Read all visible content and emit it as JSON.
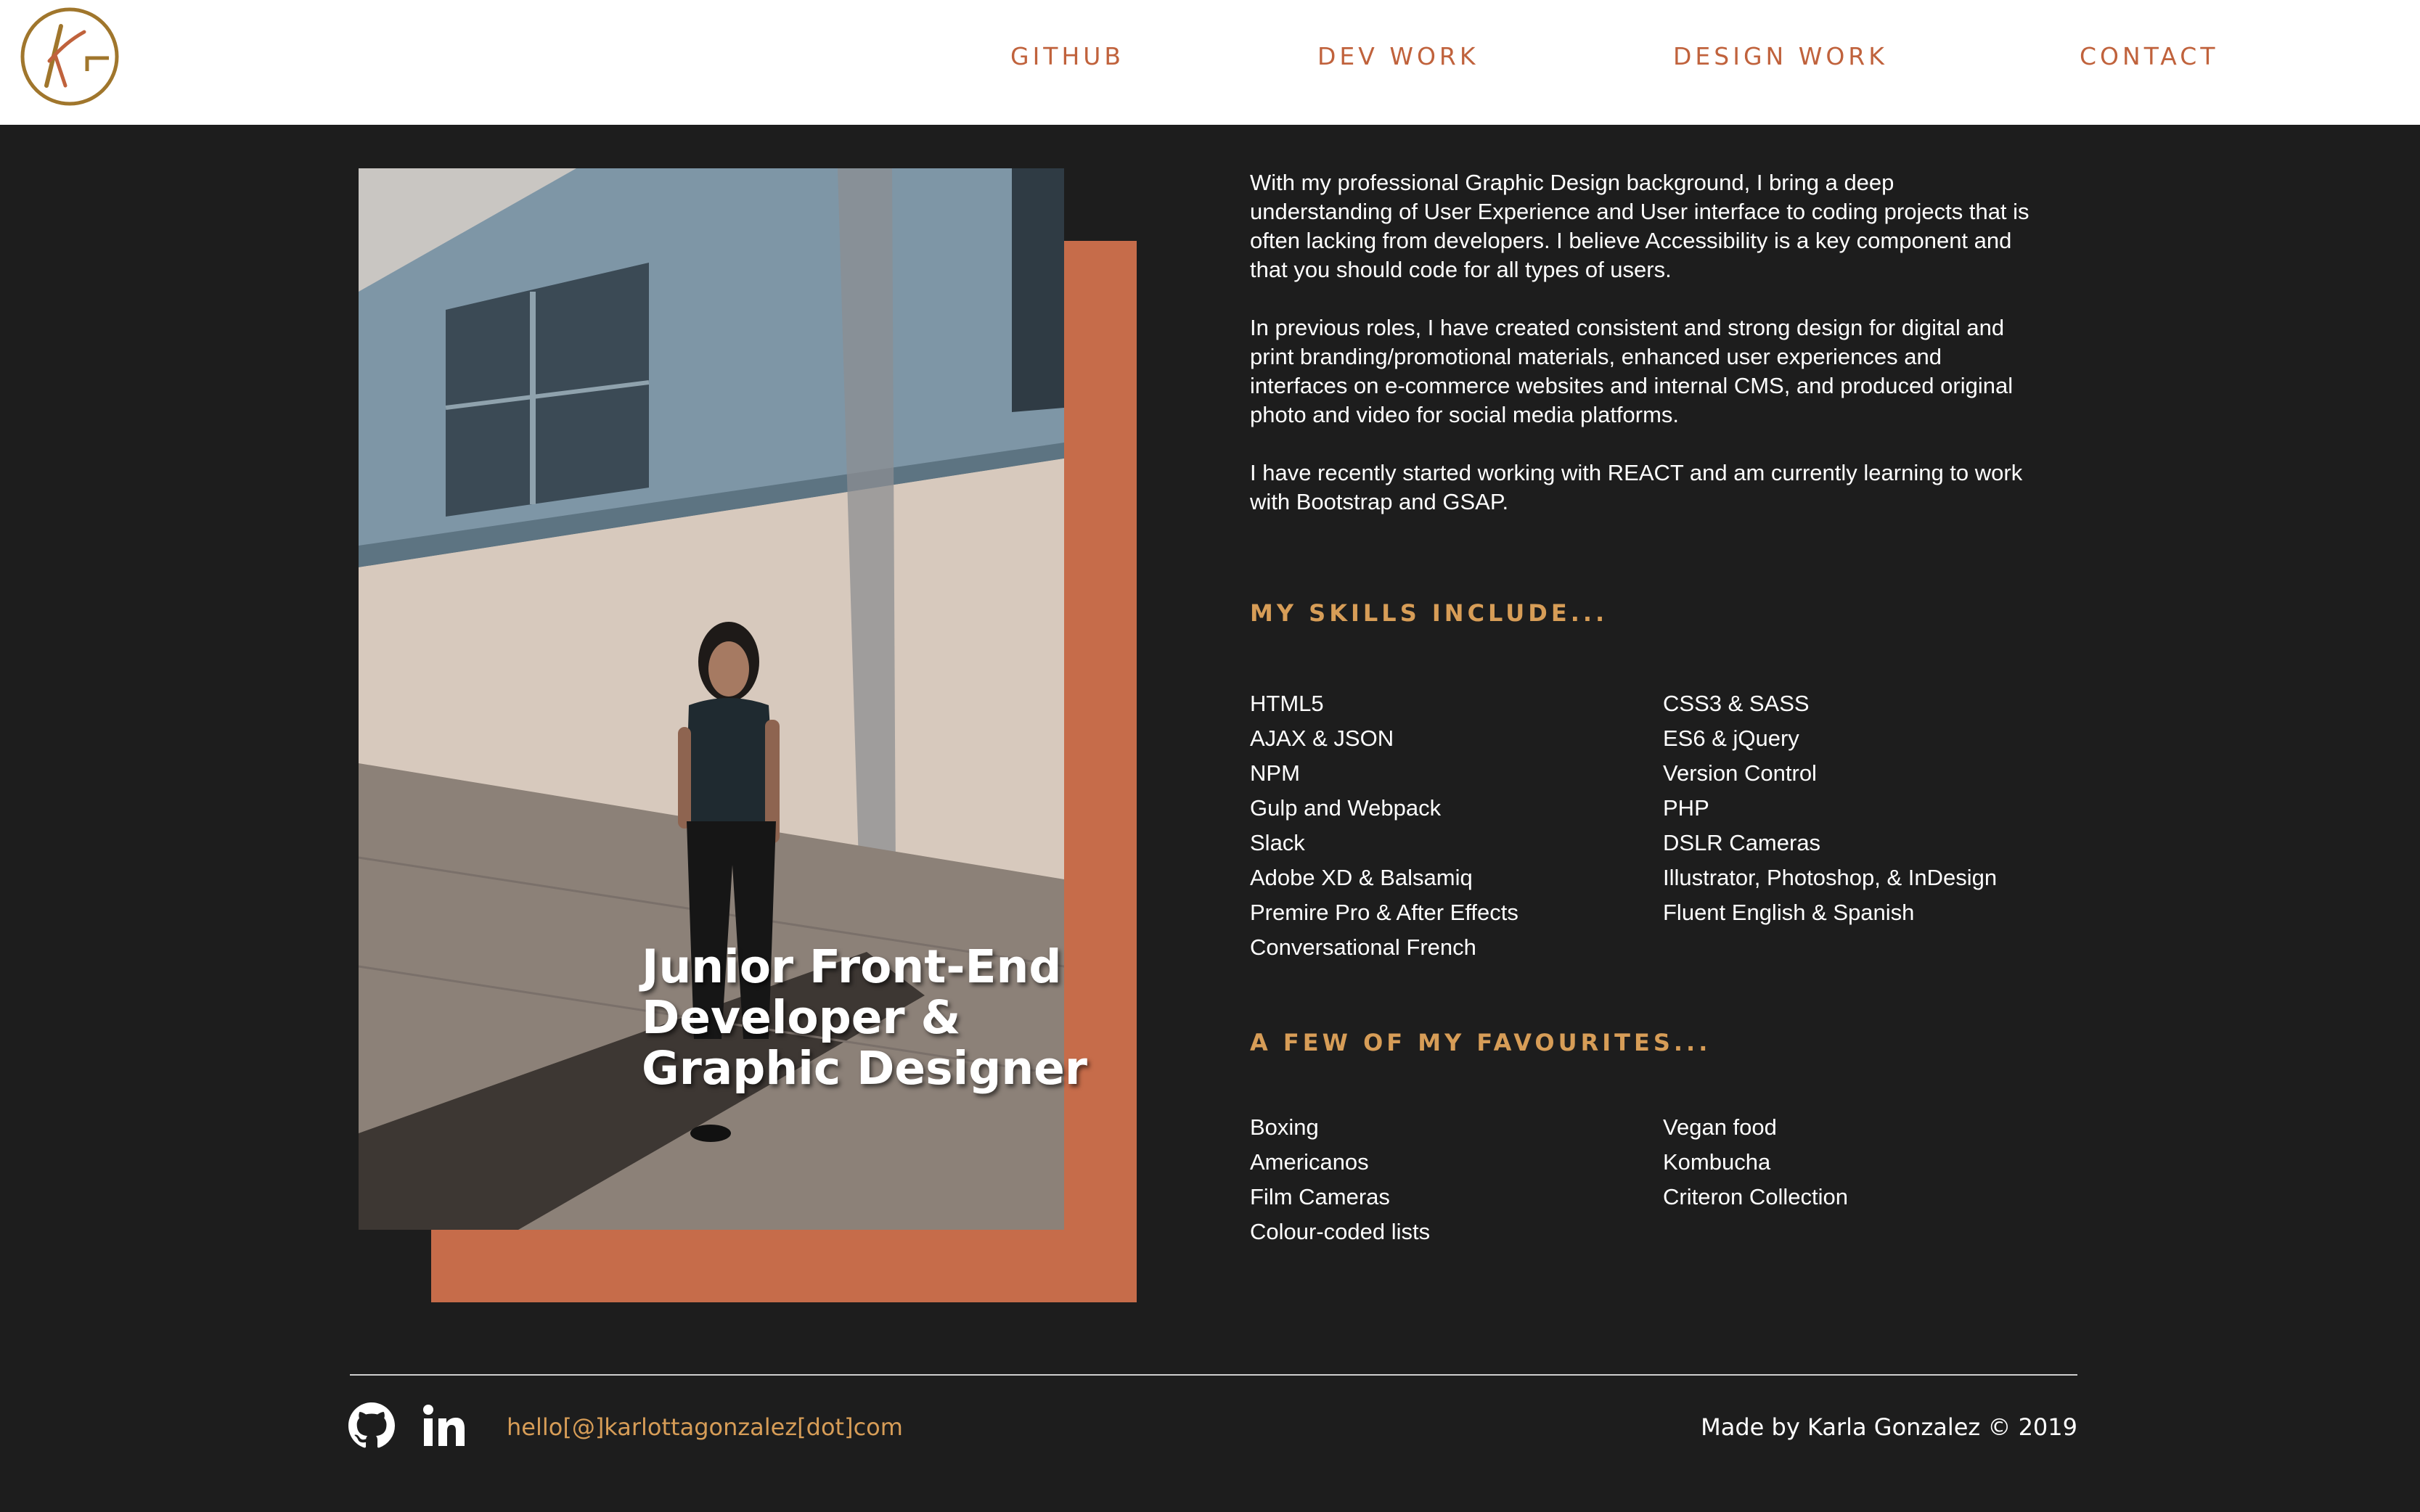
{
  "brand": {
    "logo_icon": "kg-monogram-icon",
    "accent": "#c0623c",
    "gold": "#a0762c",
    "heading_color": "#d79d57",
    "background": "#1d1d1d"
  },
  "nav": {
    "github": "GITHUB",
    "dev_work": "DEV WORK",
    "design_work": "DESIGN WORK",
    "contact": "CONTACT"
  },
  "hero": {
    "title_line1": "Junior Front-End",
    "title_line2": "Developer &",
    "title_line3": "Graphic Designer"
  },
  "intro": {
    "p1": "With my professional Graphic Design background, I bring a deep understanding of User Experience and User interface to coding projects that is often lacking from developers. I believe Accessibility is a key component and that you should code for all types of users.",
    "p2": "In previous roles, I have created consistent and strong design for digital and print branding/promotional materials, enhanced user experiences and interfaces on e-commerce websites and internal CMS, and produced original photo and video for social media platforms.",
    "p3": "I have recently started working with REACT and am currently learning to work with Bootstrap and GSAP."
  },
  "skills": {
    "heading": "MY SKILLS INCLUDE...",
    "col1": [
      "HTML5",
      "AJAX & JSON",
      "NPM",
      "Gulp and Webpack",
      "Slack",
      "Adobe XD & Balsamiq",
      "Premire Pro & After Effects",
      "Conversational French"
    ],
    "col2": [
      "CSS3 & SASS",
      "ES6 & jQuery",
      "Version Control",
      "PHP",
      "DSLR Cameras",
      "Illustrator, Photoshop, & InDesign",
      "Fluent English & Spanish"
    ]
  },
  "favourites": {
    "heading": "A FEW OF MY FAVOURITES...",
    "col1": [
      "Boxing",
      "Americanos",
      "Film Cameras",
      "Colour-coded lists"
    ],
    "col2": [
      "Vegan food",
      "Kombucha",
      "Criteron Collection"
    ]
  },
  "footer": {
    "github_icon": "github-icon",
    "linkedin_icon": "linkedin-icon",
    "email": "hello[@]karlottagonzalez[dot]com",
    "credit": "Made by Karla Gonzalez © 2019"
  }
}
